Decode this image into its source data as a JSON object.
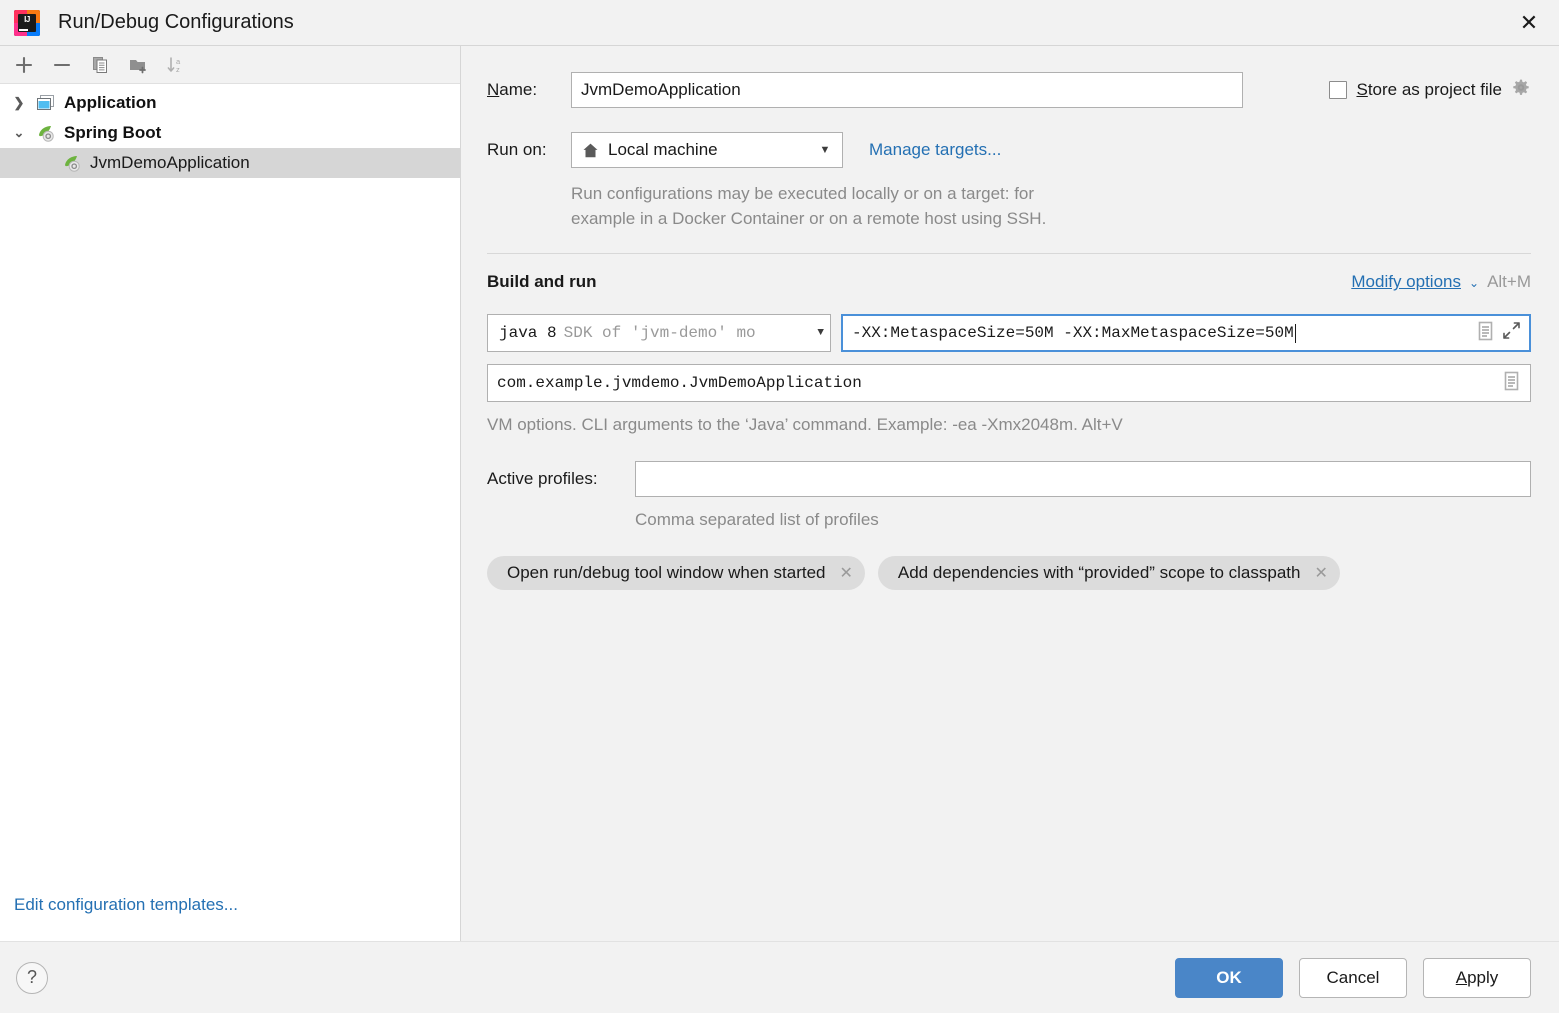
{
  "window": {
    "title": "Run/Debug Configurations",
    "logo_text": "IJ",
    "close_icon": "close-icon"
  },
  "sidebar": {
    "toolbar": [
      {
        "name": "add-configuration-button",
        "icon": "plus-icon"
      },
      {
        "name": "remove-configuration-button",
        "icon": "minus-icon"
      },
      {
        "name": "copy-configuration-button",
        "icon": "copy-icon"
      },
      {
        "name": "create-folder-button",
        "icon": "folder-add-icon"
      },
      {
        "name": "sort-configurations-button",
        "icon": "sort-alphabetical-icon"
      }
    ],
    "tree": [
      {
        "label": "Application",
        "type": "group",
        "expanded": false,
        "icon": "application-window-icon"
      },
      {
        "label": "Spring Boot",
        "type": "group",
        "expanded": true,
        "icon": "spring-leaf-icon"
      },
      {
        "label": "JvmDemoApplication",
        "type": "child",
        "selected": true,
        "icon": "spring-leaf-icon"
      }
    ],
    "edit_templates_link": "Edit configuration templates..."
  },
  "form": {
    "name_label": "Name:",
    "name_label_mnemonic": "N",
    "name_value": "JvmDemoApplication",
    "store_as_project_file_label": "Store as project file",
    "store_as_project_file_mnemonic": "S",
    "store_as_project_file_checked": false,
    "store_gear_icon": "gear-icon",
    "run_on_label": "Run on:",
    "run_on_value": "Local machine",
    "run_on_icon": "home-icon",
    "run_on_arrow": "chevron-down-icon",
    "manage_targets_link": "Manage targets...",
    "run_on_description_line1": "Run configurations may be executed locally or on a target: for",
    "run_on_description_line2": "example in a Docker Container or on a remote host using SSH."
  },
  "build_and_run": {
    "section_title": "Build and run",
    "modify_options_link": "Modify options",
    "modify_options_chevron": "chevron-down-icon",
    "modify_options_shortcut": "Alt+M",
    "sdk_value_primary": "java 8",
    "sdk_value_secondary": "SDK of 'jvm-demo' mo",
    "sdk_arrow": "chevron-down-icon",
    "vm_options_value": "-XX:MetaspaceSize=50M -XX:MaxMetaspaceSize=50M",
    "vm_options_focused": true,
    "vm_options_doc_icon": "document-icon",
    "vm_options_expand_icon": "expand-arrows-icon",
    "main_class_value": "com.example.jvmdemo.JvmDemoApplication",
    "main_class_doc_icon": "document-icon",
    "vm_options_hint": "VM options. CLI arguments to the ‘Java’ command. Example: -ea -Xmx2048m. Alt+V",
    "active_profiles_label": "Active profiles:",
    "active_profiles_value": "",
    "active_profiles_hint": "Comma separated list of profiles",
    "chips": [
      {
        "label": "Open run/debug tool window when started",
        "remove_icon": "close-icon"
      },
      {
        "label": "Add dependencies with “provided” scope to classpath",
        "remove_icon": "close-icon"
      }
    ]
  },
  "footer": {
    "help_icon": "question-mark-icon",
    "ok_label": "OK",
    "cancel_label": "Cancel",
    "apply_label": "Apply",
    "apply_mnemonic": "A"
  },
  "colors": {
    "accent_blue": "#2470b3",
    "primary_button": "#4a86c8",
    "focus_border": "#4a90d9",
    "selection_gray": "#d6d6d6",
    "panel_bg": "#f2f2f2",
    "hint_gray": "#8a8a8a"
  }
}
